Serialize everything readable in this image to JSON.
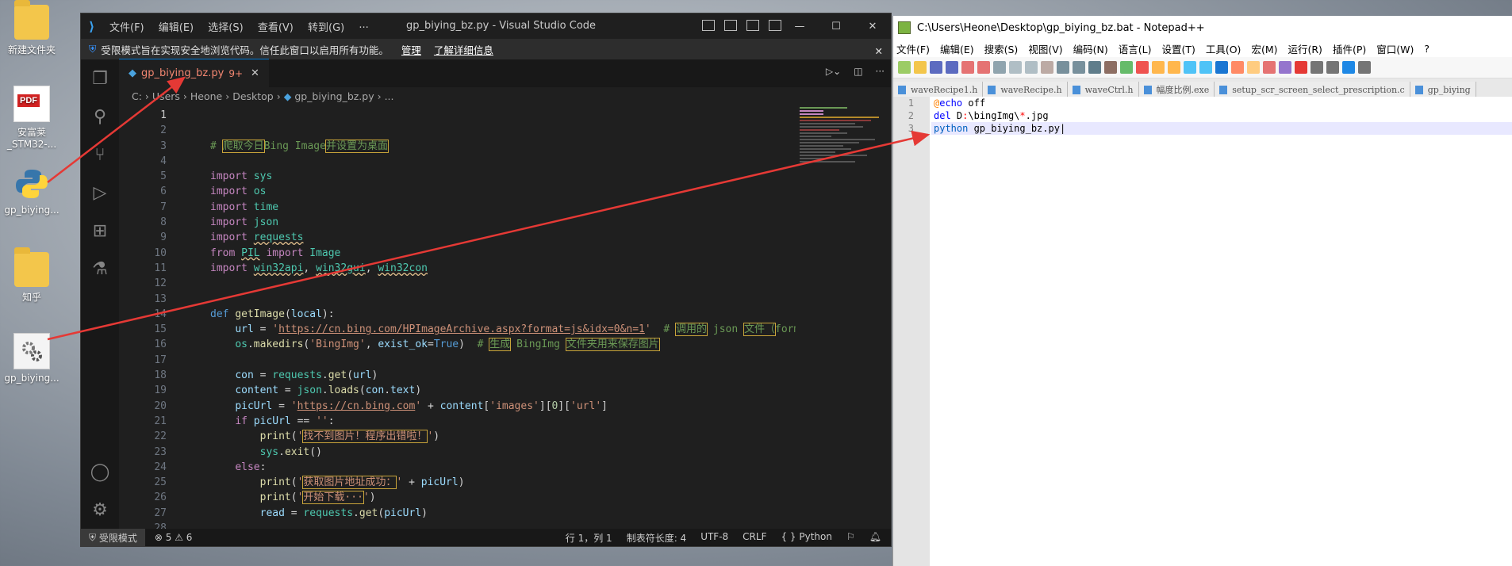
{
  "desktop": {
    "icons": [
      {
        "label": "新建文件夹",
        "icon": "folder-icon"
      },
      {
        "label": "安富莱_STM32-...",
        "icon": "pdf-icon"
      },
      {
        "label": "gp_biying...",
        "icon": "python-file-icon"
      },
      {
        "label": "知乎",
        "icon": "folder-icon"
      },
      {
        "label": "gp_biying...",
        "icon": "bat-file-icon"
      }
    ]
  },
  "vscode": {
    "menu": [
      "文件(F)",
      "编辑(E)",
      "选择(S)",
      "查看(V)",
      "转到(G)",
      "···"
    ],
    "window_title": "gp_biying_bz.py - Visual Studio Code",
    "banner": {
      "text": "受限模式旨在实现安全地浏览代码。信任此窗口以启用所有功能。",
      "manage": "管理",
      "learn_more": "了解详细信息"
    },
    "tab": {
      "name": "gp_biying_bz.py",
      "badge": "9+"
    },
    "breadcrumb": [
      "C:",
      "Users",
      "Heone",
      "Desktop",
      "gp_biying_bz.py",
      "..."
    ],
    "line_numbers": [
      "1",
      "2",
      "3",
      "4",
      "5",
      "6",
      "7",
      "8",
      "9",
      "10",
      "11",
      "12",
      "13",
      "14",
      "15",
      "16",
      "17",
      "18",
      "19",
      "20",
      "21",
      "22",
      "23",
      "24",
      "25",
      "26",
      "27",
      "28"
    ],
    "status": {
      "restricted": "受限模式",
      "errors": "5",
      "warnings": "6",
      "position": "行 1，列 1",
      "tab_size": "制表符长度: 4",
      "encoding": "UTF-8",
      "eol": "CRLF",
      "language": "Python"
    }
  },
  "notepadpp": {
    "title": "C:\\Users\\Heone\\Desktop\\gp_biying_bz.bat - Notepad++",
    "menu": [
      "文件(F)",
      "编辑(E)",
      "搜索(S)",
      "视图(V)",
      "编码(N)",
      "语言(L)",
      "设置(T)",
      "工具(O)",
      "宏(M)",
      "运行(R)",
      "插件(P)",
      "窗口(W)",
      "?"
    ],
    "tabs": [
      "waveRecipe1.h",
      "waveRecipe.h",
      "waveCtrl.h",
      "幅度比例.exe",
      "setup_scr_screen_select_prescription.c",
      "gp_biying"
    ],
    "line_numbers": [
      "1",
      "2",
      "3"
    ]
  }
}
